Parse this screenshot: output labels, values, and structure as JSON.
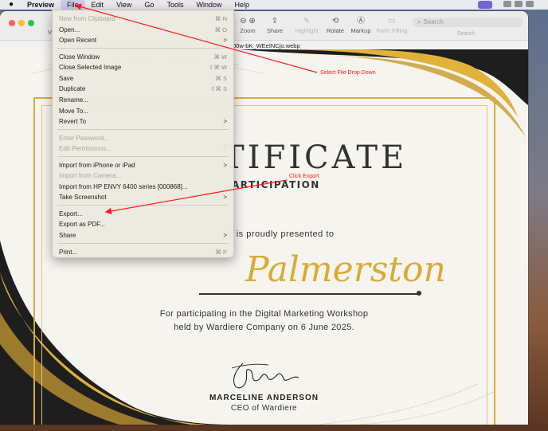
{
  "menubar": {
    "app_name": "Preview",
    "items": [
      "File",
      "Edit",
      "View",
      "Go",
      "Tools",
      "Window",
      "Help"
    ]
  },
  "toolbar": {
    "partial_label": "Vi",
    "zoom_label": "Zoom",
    "share_label": "Share",
    "highlight_label": "Highlight",
    "rotate_label": "Rotate",
    "markup_label": "Markup",
    "form_filling_label": "Form Filling",
    "search_placeholder": "Search",
    "search_label": "Search"
  },
  "window": {
    "filename": "00w-bK_WEeINCjo.webp"
  },
  "file_menu": {
    "items": [
      {
        "label": "New from Clipboard",
        "shortcut": "⌘ N",
        "disabled": true
      },
      {
        "label": "Open...",
        "shortcut": "⌘ O"
      },
      {
        "label": "Open Recent",
        "submenu": ">"
      },
      {
        "label": "Close Window",
        "shortcut": "⌘ W"
      },
      {
        "label": "Close Selected Image",
        "shortcut": "⇧⌘ W"
      },
      {
        "label": "Save",
        "shortcut": "⌘ S"
      },
      {
        "label": "Duplicate",
        "shortcut": "⇧⌘ S"
      },
      {
        "label": "Rename..."
      },
      {
        "label": "Move To..."
      },
      {
        "label": "Revert To",
        "submenu": ">"
      },
      {
        "label": "Enter Password...",
        "disabled": true
      },
      {
        "label": "Edit Permissions...",
        "disabled": true
      },
      {
        "label": "Import from iPhone or iPad",
        "submenu": ">"
      },
      {
        "label": "Import from Camera...",
        "disabled": true
      },
      {
        "label": "Import from HP ENVY 6400 series [000868]..."
      },
      {
        "label": "Take Screenshot",
        "submenu": ">"
      },
      {
        "label": "Export..."
      },
      {
        "label": "Export as PDF..."
      },
      {
        "label": "Share",
        "submenu": ">"
      },
      {
        "label": "Print...",
        "shortcut": "⌘ P"
      }
    ]
  },
  "certificate": {
    "title_partial": "TIFICATE",
    "subtitle_partial": "ARTICIPATION",
    "presented_partial": "te is proudly presented to",
    "recipient_partial": "Palmerston",
    "line1": "For participating in the Digital Marketing Workshop",
    "line2": "held by Wardiere Company on 6 June 2025.",
    "signer_name": "MARCELINE ANDERSON",
    "signer_role": "CEO of Wardiere"
  },
  "annotations": {
    "select_file": "Select File Drop Down",
    "click_export": "Click Export",
    "color": "#ff1a1a"
  },
  "colors": {
    "gold": "#d8ac3c",
    "name_gold": "#d9ab35",
    "menu_bg": "#ece9e0",
    "dark_swoosh": "#1e1e1e"
  }
}
